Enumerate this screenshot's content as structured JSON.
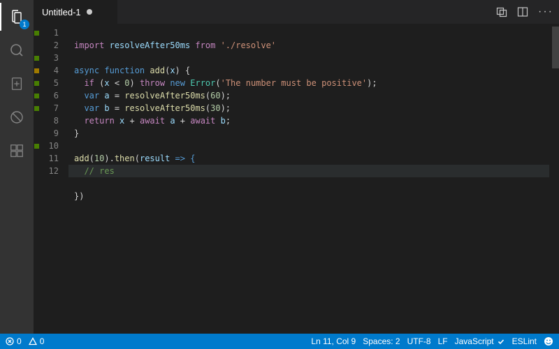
{
  "activitybar": {
    "badge": "1"
  },
  "tab": {
    "title": "Untitled-1"
  },
  "gutter": [
    "green",
    "",
    "green",
    "yellow",
    "green",
    "green",
    "green",
    "",
    "",
    "green",
    "",
    ""
  ],
  "lineNumbers": [
    "1",
    "2",
    "3",
    "4",
    "5",
    "6",
    "7",
    "8",
    "9",
    "10",
    "11",
    "12"
  ],
  "code": {
    "l1": {
      "import": "import",
      "name": "resolveAfter50ms",
      "from": "from",
      "path": "'./resolve'"
    },
    "l3": {
      "async": "async",
      "function": "function",
      "name": "add",
      "param": "x",
      "open": ") {"
    },
    "l4": {
      "if": "if",
      "cond_open": " (",
      "var": "x",
      "op": " < ",
      "zero": "0",
      "cond_close": ") ",
      "throw": "throw",
      "new": "new",
      "err": "Error",
      "msg": "'The number must be positive'",
      "end": ");"
    },
    "l5": {
      "var_kw": "var",
      "name": "a",
      "eq": " = ",
      "fn": "resolveAfter50ms",
      "arg": "60",
      "end": ");"
    },
    "l6": {
      "var_kw": "var",
      "name": "b",
      "eq": " = ",
      "fn": "resolveAfter50ms",
      "arg": "30",
      "end": ");"
    },
    "l7": {
      "return": "return",
      "x": "x",
      "plus1": " + ",
      "await1": "await",
      "a": "a",
      "plus2": " + ",
      "await2": "await",
      "b": "b",
      "semi": ";"
    },
    "l8": {
      "brace": "}"
    },
    "l10": {
      "fn": "add",
      "arg": "10",
      "then": "then",
      "param": "result",
      "arrow": " => {"
    },
    "l11": {
      "comment": "// res"
    },
    "l12": {
      "close": "})"
    }
  },
  "statusbar": {
    "errors": "0",
    "warnings": "0",
    "lncol": "Ln 11, Col 9",
    "spaces": "Spaces: 2",
    "encoding": "UTF-8",
    "eol": "LF",
    "language": "JavaScript",
    "eslint": "ESLint"
  }
}
